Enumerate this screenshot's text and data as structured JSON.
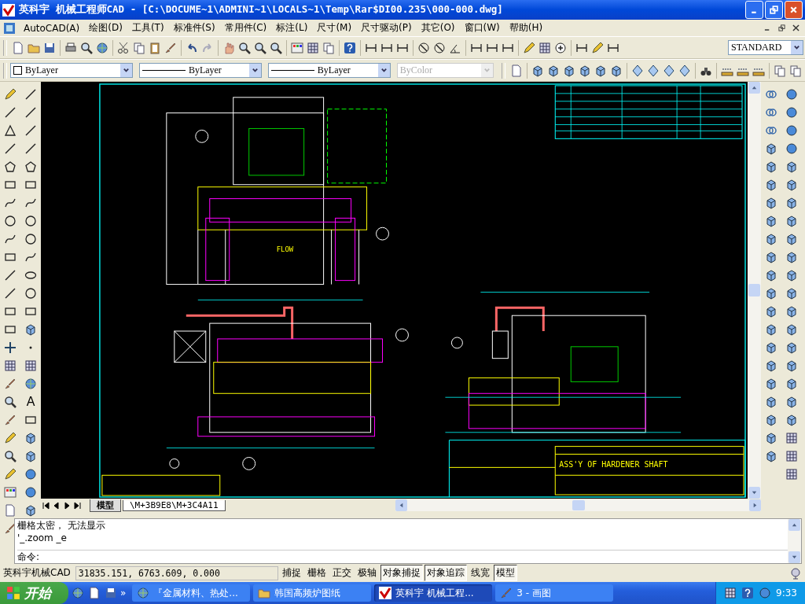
{
  "window": {
    "title": "英科宇 机械工程师CAD - [C:\\DOCUME~1\\ADMINI~1\\LOCALS~1\\Temp\\Rar$DI00.235\\000-000.dwg]"
  },
  "menu": [
    "AutoCAD(A)",
    "绘图(D)",
    "工具(T)",
    "标准件(S)",
    "常用件(C)",
    "标注(L)",
    "尺寸(M)",
    "尺寸驱动(P)",
    "其它(O)",
    "窗口(W)",
    "帮助(H)"
  ],
  "text_style": "STANDARD",
  "property_dropdowns": [
    {
      "kind": "layer",
      "value": "ByLayer",
      "disabled": false
    },
    {
      "kind": "linetype",
      "value": "ByLayer",
      "disabled": false
    },
    {
      "kind": "linetype",
      "value": "ByLayer",
      "disabled": false
    },
    {
      "kind": "plain",
      "value": "ByColor",
      "disabled": true
    }
  ],
  "text_tool": "A",
  "drawing": {
    "flow_label": "FLOW",
    "title_block_name": "ASS'Y OF HARDENER SHAFT"
  },
  "layout_tabs": [
    {
      "label": "模型",
      "selected": true
    },
    {
      "label": "\\M+3B9E8\\M+3C4A11",
      "selected": false
    }
  ],
  "command_window": {
    "lines": [
      "栅格太密， 无法显示",
      "'_.zoom _e"
    ],
    "prompt": "命令:"
  },
  "status_bar": {
    "app": "英科宇机械CAD",
    "coordinates": "31835.151, 6763.609, 0.000",
    "toggles": [
      {
        "label": "捕捉",
        "on": false
      },
      {
        "label": "栅格",
        "on": false
      },
      {
        "label": "正交",
        "on": false
      },
      {
        "label": "极轴",
        "on": false
      },
      {
        "label": "对象捕捉",
        "on": true
      },
      {
        "label": "对象追踪",
        "on": true
      },
      {
        "label": "线宽",
        "on": false
      },
      {
        "label": "模型",
        "on": true
      }
    ]
  },
  "taskbar": {
    "start": "开始",
    "more": "»",
    "tasks": [
      {
        "label": "『金属材料、热处...",
        "selected": false,
        "kind": "browser"
      },
      {
        "label": "韩国高频炉图纸",
        "selected": false,
        "kind": "folder"
      },
      {
        "label": "英科宇 机械工程...",
        "selected": true,
        "kind": "cad"
      },
      {
        "label": "3 - 画图",
        "selected": false,
        "kind": "paint"
      }
    ],
    "clock": "9:33"
  }
}
